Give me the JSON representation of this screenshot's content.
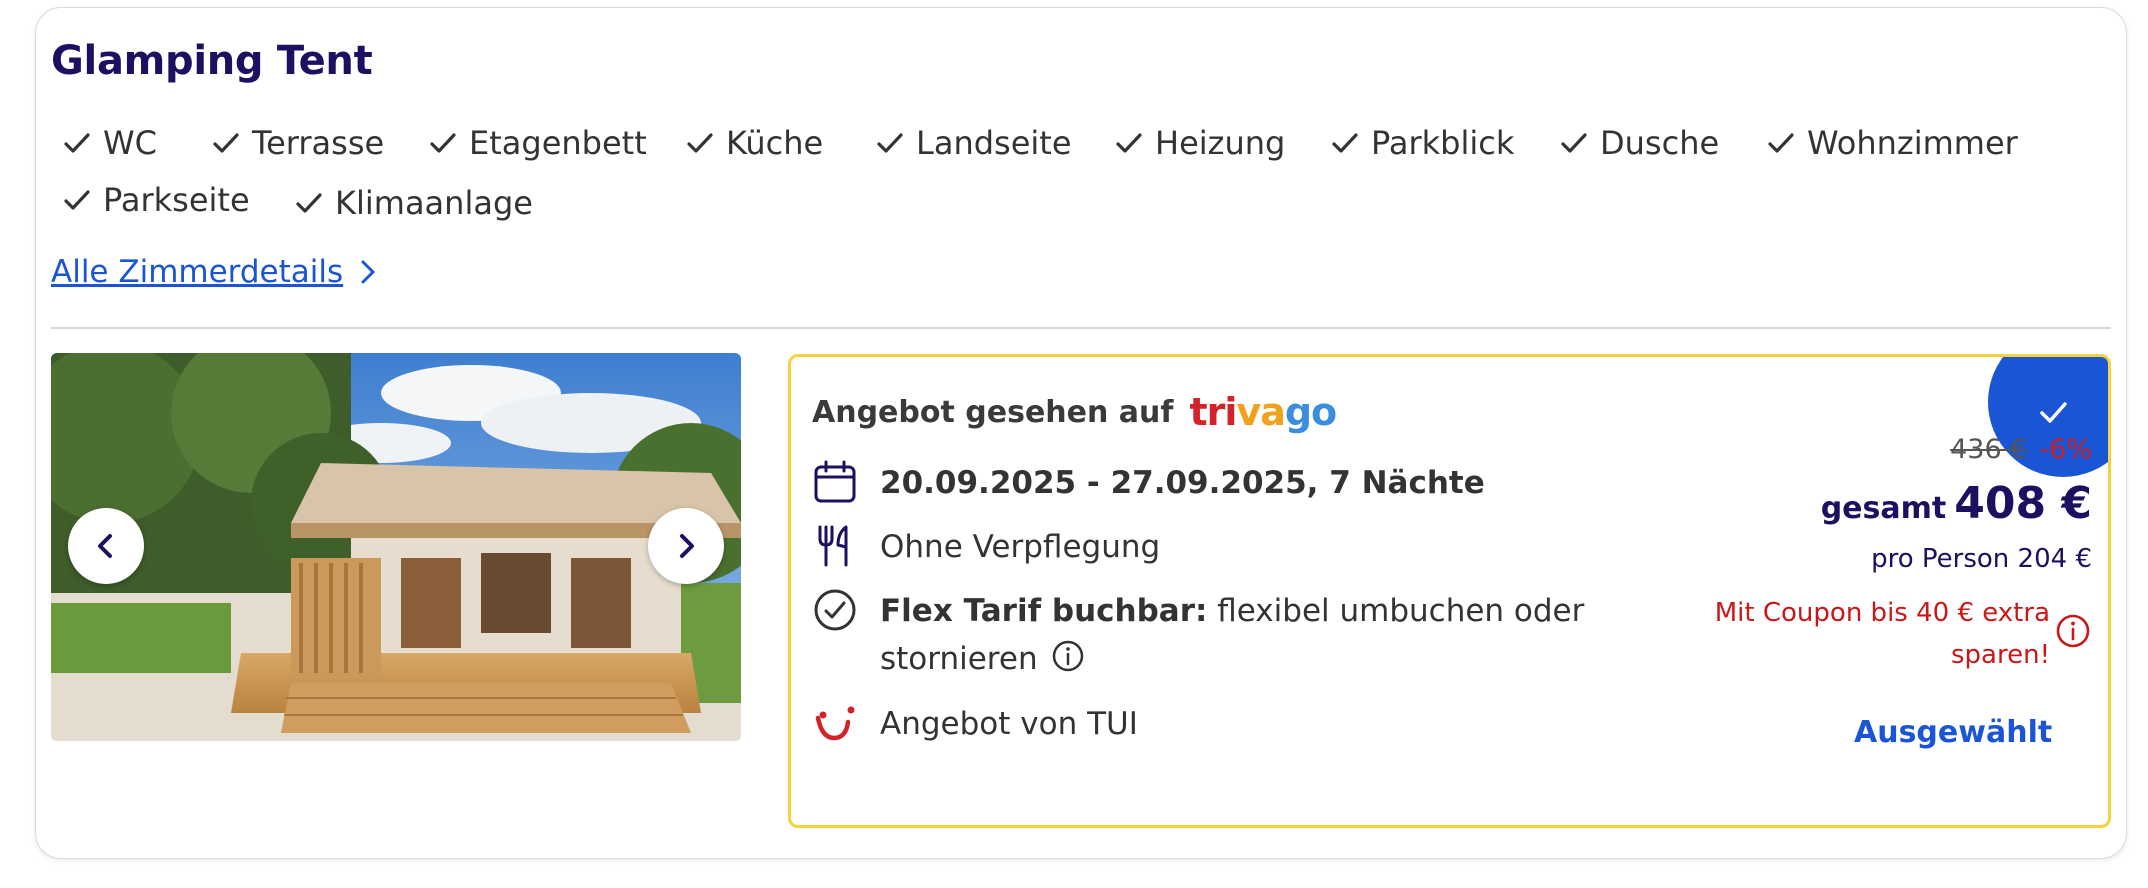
{
  "room": {
    "title": "Glamping Tent",
    "amenities": [
      "WC",
      "Terrasse",
      "Etagenbett",
      "Küche",
      "Landseite",
      "Heizung",
      "Parkblick",
      "Dusche",
      "Wohnzimmer",
      "Parkseite",
      "Klimaanlage"
    ],
    "details_link": "Alle Zimmerdetails"
  },
  "gallery": {
    "prev_icon": "chevron-left-icon",
    "next_icon": "chevron-right-icon"
  },
  "offer": {
    "seen_on": "Angebot gesehen auf",
    "brand": "trivago",
    "brand_letters": [
      {
        "char": "t",
        "color": "#d3232a"
      },
      {
        "char": "r",
        "color": "#d3232a"
      },
      {
        "char": "i",
        "color": "#d3232a"
      },
      {
        "char": "v",
        "color": "#f0a11d"
      },
      {
        "char": "a",
        "color": "#f0a11d"
      },
      {
        "char": "g",
        "color": "#3b8ede"
      },
      {
        "char": "o",
        "color": "#3b8ede"
      }
    ],
    "dates": "20.09.2025 - 27.09.2025, 7 Nächte",
    "board": "Ohne Verpflegung",
    "flex_bold": "Flex Tarif buchbar:",
    "flex_line1": "flexibel umbuchen oder",
    "flex_line2": "stornieren",
    "provider": "Angebot von TUI",
    "old_price": "436 €",
    "discount": "-6%",
    "total_label": "gesamt",
    "total_price": "408 €",
    "per_person": "pro Person 204 €",
    "coupon_line1": "Mit Coupon bis 40 € extra",
    "coupon_line2": "sparen!",
    "selected_label": "Ausgewählt"
  },
  "colors": {
    "accent": "#1a55d6",
    "title": "#1c1060",
    "highlight_border": "#f4d33c",
    "discount": "#d11f1f",
    "provider_logo": "#d3232a"
  }
}
